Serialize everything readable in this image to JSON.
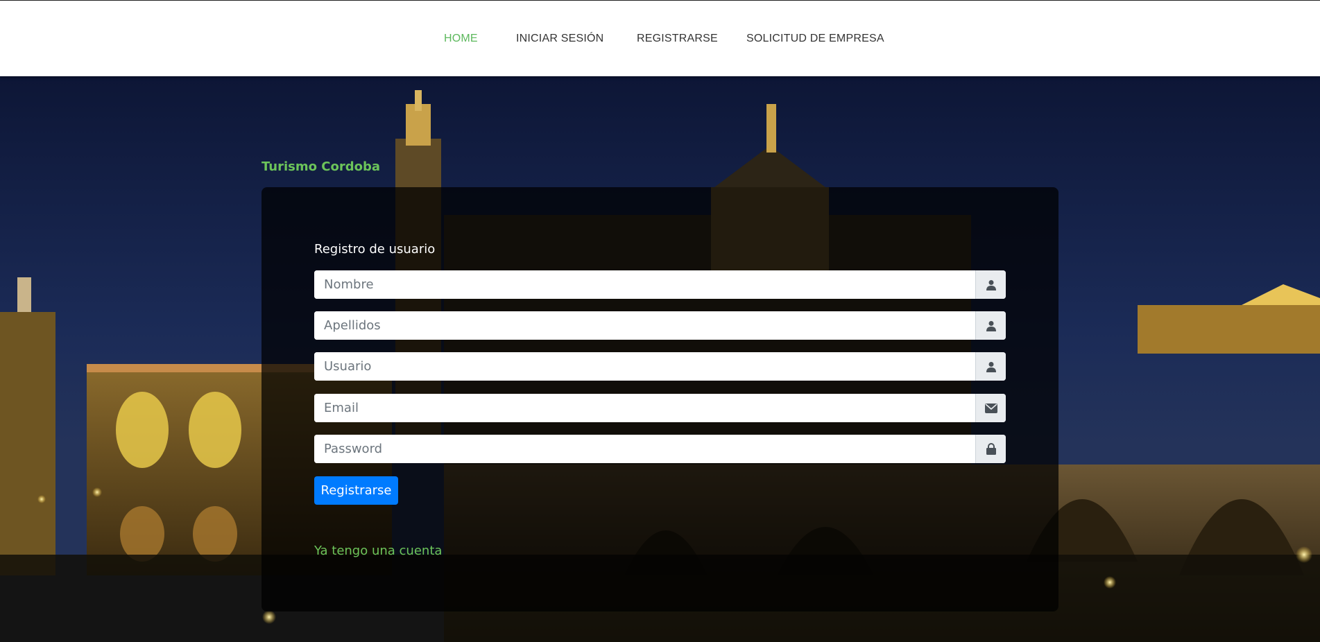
{
  "nav": {
    "items": [
      {
        "label": "HOME",
        "active": true
      },
      {
        "label": "INICIAR SESIÓN",
        "active": false
      },
      {
        "label": "REGISTRARSE",
        "active": false
      },
      {
        "label": "SOLICITUD DE EMPRESA",
        "active": false
      }
    ]
  },
  "brand": "Turismo Cordoba",
  "form": {
    "title": "Registro de usuario",
    "fields": [
      {
        "placeholder": "Nombre",
        "icon": "user-icon",
        "type": "text"
      },
      {
        "placeholder": "Apellidos",
        "icon": "user-icon",
        "type": "text"
      },
      {
        "placeholder": "Usuario",
        "icon": "user-icon",
        "type": "text"
      },
      {
        "placeholder": "Email",
        "icon": "envelope-icon",
        "type": "email"
      },
      {
        "placeholder": "Password",
        "icon": "lock-icon",
        "type": "password"
      }
    ],
    "submit_label": "Registrarse",
    "login_link": "Ya tengo una cuenta"
  },
  "colors": {
    "accent_green": "#6cc45a",
    "nav_active": "#5cb85c",
    "button_blue": "#007bff"
  }
}
